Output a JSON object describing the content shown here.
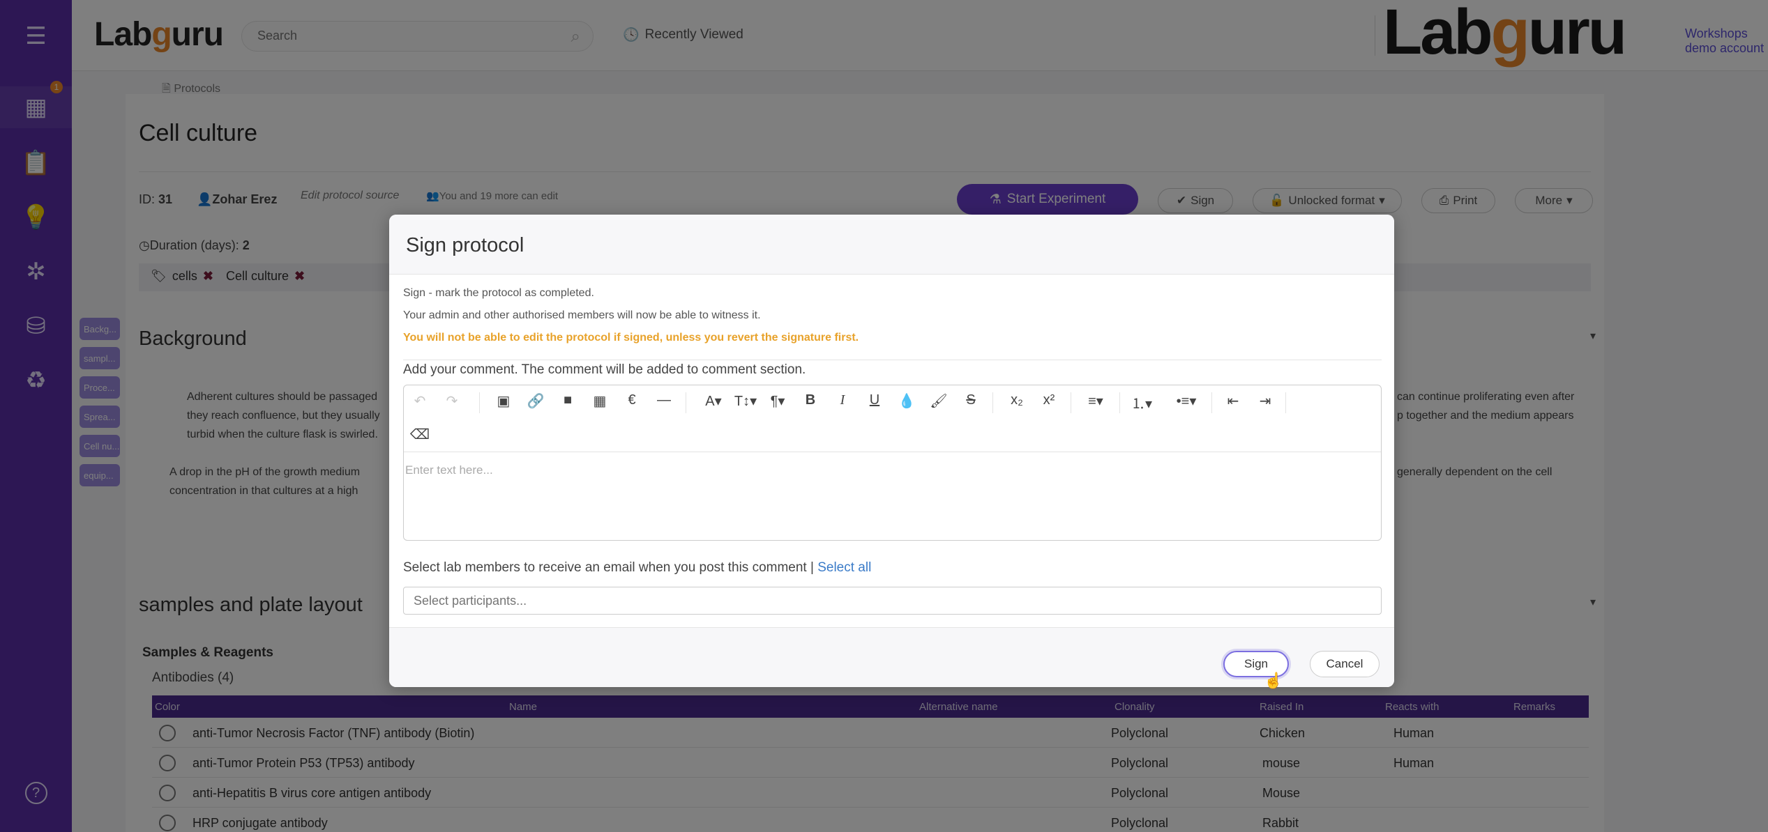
{
  "sidebar": {
    "badge": "1",
    "items": [
      {
        "name": "menu-icon",
        "glyph": "☰"
      },
      {
        "name": "dashboard-icon",
        "glyph": "▦"
      },
      {
        "name": "clipboard-icon",
        "glyph": "📋"
      },
      {
        "name": "lightbulb-icon",
        "glyph": "💡"
      },
      {
        "name": "network-icon",
        "glyph": "✲"
      },
      {
        "name": "inventory-icon",
        "glyph": "⛁"
      },
      {
        "name": "recycle-icon",
        "glyph": "♻"
      },
      {
        "name": "help-icon",
        "glyph": "?"
      }
    ]
  },
  "topbar": {
    "logo_pre": "Lab",
    "logo_g": "g",
    "logo_post": "uru",
    "search_placeholder": "Search",
    "recently_viewed": "Recently Viewed",
    "account": "Workshops demo account"
  },
  "protocol": {
    "breadcrumb": "Protocols",
    "title": "Cell culture",
    "id_label": "ID:",
    "id_value": "31",
    "owner": "Zohar Erez",
    "edit_source": "Edit protocol source",
    "editors": "You and 19 more can edit",
    "start_experiment": "Start Experiment",
    "sign": "Sign",
    "unlocked_format": "Unlocked format",
    "print": "Print",
    "more": "More",
    "duration_label": "Duration (days):",
    "duration_value": "2",
    "tags": [
      "cells",
      "Cell culture"
    ],
    "background_title": "Background",
    "bg_line1_left": "Adherent cultures should be passaged",
    "bg_line2_left": "they reach confluence, but they usually",
    "bg_line3_left": "turbid when the culture flask is swirled.",
    "bg_line4_left": "A drop in the pH of the growth medium",
    "bg_line5_left": "concentration in that cultures at a high",
    "bg_line1_right": "can continue proliferating even after",
    "bg_line2_right": "p together and the medium appears",
    "bg_line4_right": "generally dependent on the cell",
    "side_tabs": [
      "Backg...",
      "sampl...",
      "Proce...",
      "Sprea...",
      "Cell nu...",
      "equip..."
    ],
    "samples_title": "samples and plate layout",
    "samples_reagents": "Samples & Reagents",
    "antibodies": "Antibodies (4)"
  },
  "table": {
    "headers": [
      "Color",
      "Name",
      "Alternative name",
      "Clonality",
      "Raised In",
      "Reacts with",
      "Remarks"
    ],
    "rows": [
      {
        "name": "anti-Tumor Necrosis Factor (TNF) antibody (Biotin)",
        "clonality": "Polyclonal",
        "raised": "Chicken",
        "reacts": "Human"
      },
      {
        "name": "anti-Tumor Protein P53 (TP53) antibody",
        "clonality": "Polyclonal",
        "raised": "mouse",
        "reacts": "Human"
      },
      {
        "name": "anti-Hepatitis B virus core antigen antibody",
        "clonality": "Polyclonal",
        "raised": "Mouse",
        "reacts": ""
      },
      {
        "name": "HRP conjugate antibody",
        "clonality": "Polyclonal",
        "raised": "Rabbit",
        "reacts": ""
      }
    ]
  },
  "modal": {
    "title": "Sign protocol",
    "line1": "Sign - mark the protocol as completed.",
    "line2": "Your admin and other authorised members will now be able to witness it.",
    "warning": "You will not be able to edit the protocol if signed, unless you revert the signature first.",
    "comment_label": "Add your comment. The comment will be added to comment section.",
    "editor_placeholder": "Enter text here...",
    "members_label": "Select lab members to receive an email when you post this comment |",
    "select_all": "Select all",
    "participants_placeholder": "Select participants...",
    "sign_button": "Sign",
    "cancel_button": "Cancel"
  },
  "colors": {
    "sidebar": "#5b2ea8",
    "accent": "#6a3fcf",
    "warning": "#e8a22a",
    "link": "#3a7bc8"
  }
}
